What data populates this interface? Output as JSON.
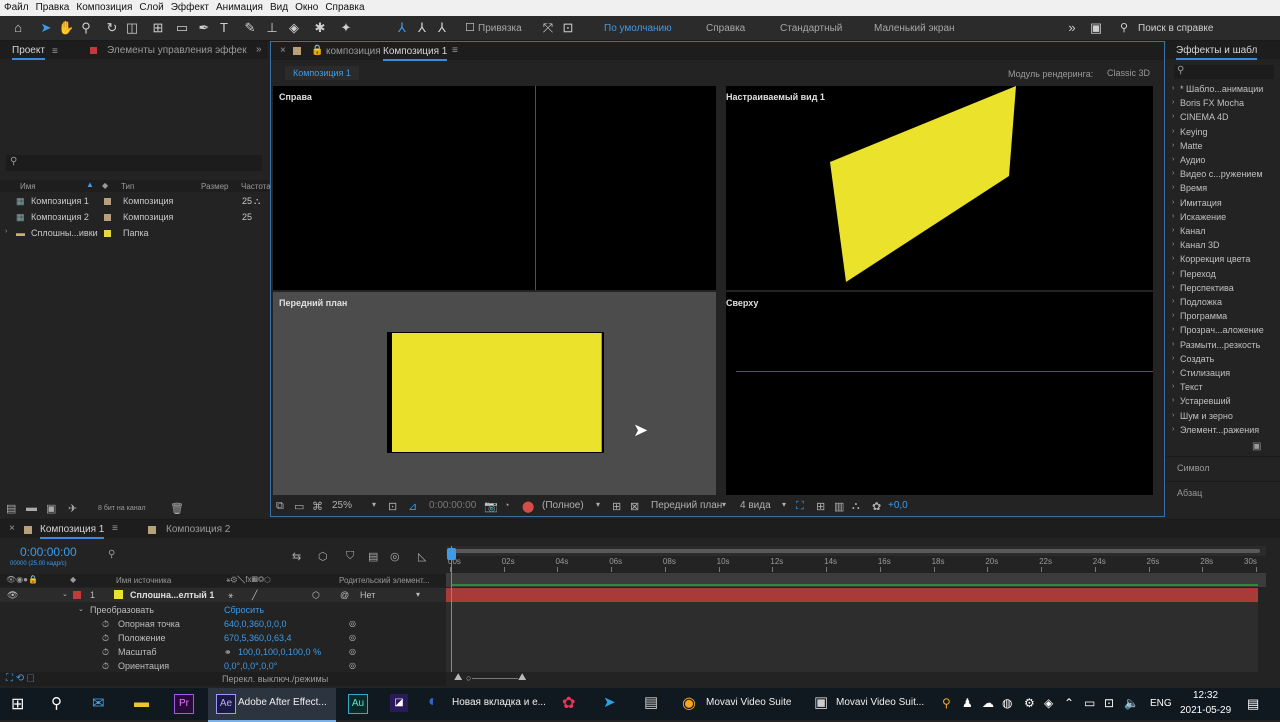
{
  "menu": [
    "Файл",
    "Правка",
    "Композиция",
    "Слой",
    "Эффект",
    "Анимация",
    "Вид",
    "Окно",
    "Справка"
  ],
  "toolbar": {
    "snap_label": "Привязка",
    "workspaces": [
      "По умолчанию",
      "Справка",
      "Стандартный",
      "Маленький экран"
    ],
    "search_placeholder": "Поиск в справке"
  },
  "project": {
    "tab_project": "Проект",
    "tab_effects_controls": "Элементы управления эффек",
    "search_placeholder": "",
    "columns": [
      "Имя",
      "Тип",
      "Размер",
      "Частота"
    ],
    "items": [
      {
        "name": "Композиция 1",
        "type": "Композиция",
        "rate": "25",
        "color": "#b8a07a"
      },
      {
        "name": "Композиция 2",
        "type": "Композиция",
        "rate": "25",
        "color": "#b8a07a"
      },
      {
        "name": "Сплошны...ивки",
        "type": "Папка",
        "rate": "",
        "color": "#e6d64b"
      }
    ],
    "bit_depth": "8 бит на канал"
  },
  "composition": {
    "tab_prefix": "композиция",
    "tab_name": "Композиция 1",
    "breadcrumb": "Композиция 1",
    "renderer_label": "Модуль рендеринга:",
    "renderer_value": "Classic 3D",
    "views": [
      "Справа",
      "Настраиваемый вид 1",
      "Передний план",
      "Сверху"
    ],
    "footer": {
      "zoom": "25%",
      "timecode": "0:00:00:00",
      "resolution": "(Полное)",
      "active_camera": "Передний план",
      "view_layout": "4 вида",
      "exposure": "+0,0"
    }
  },
  "effects_panel": {
    "title": "Эффекты и шабл",
    "search_placeholder": "",
    "items": [
      "* Шабло...анимации",
      "Boris FX Mocha",
      "CINEMA 4D",
      "Keying",
      "Matte",
      "Аудио",
      "Видео с...ружением",
      "Время",
      "Имитация",
      "Искажение",
      "Канал",
      "Канал 3D",
      "Коррекция цвета",
      "Переход",
      "Перспектива",
      "Подложка",
      "Программа",
      "Прозрач...аложение",
      "Размыти...резкость",
      "Создать",
      "Стилизация",
      "Текст",
      "Устаревший",
      "Шум и зерно",
      "Элемент...ражения"
    ],
    "symbol_panel": "Символ",
    "paragraph_panel": "Абзац"
  },
  "timeline": {
    "tabs": [
      "Композиция 1",
      "Композиция 2"
    ],
    "current_time": "0:00:00:00",
    "frame_info": "00000 (25.00 кадр/с)",
    "col_source": "Имя источника",
    "col_parent": "Родительский элемент...",
    "layer": {
      "index": "1",
      "name": "Сплошна...елтый 1",
      "parent": "Нет"
    },
    "transform_label": "Преобразовать",
    "reset_label": "Сбросить",
    "properties": [
      {
        "name": "Опорная точка",
        "value": "640,0,360,0,0,0"
      },
      {
        "name": "Положение",
        "value": "670,5,360,0,63,4"
      },
      {
        "name": "Масштаб",
        "value": "100,0,100,0,100,0 %"
      },
      {
        "name": "Ориентация",
        "value": "0,0°,0,0°,0,0°"
      }
    ],
    "toggle_label": "Перекл. выключ./режимы",
    "ruler": [
      "00s",
      "02s",
      "04s",
      "06s",
      "08s",
      "10s",
      "12s",
      "14s",
      "16s",
      "18s",
      "20s",
      "22s",
      "24s",
      "26s",
      "28s",
      "30s"
    ]
  },
  "taskbar": {
    "apps": [
      {
        "label": "Adobe After Effect..."
      },
      {
        "label": "Новая вкладка и е..."
      },
      {
        "label": "Movavi Video Suite"
      },
      {
        "label": "Movavi Video Suit..."
      }
    ],
    "lang": "ENG",
    "time": "12:32",
    "date": "2021-05-29"
  },
  "colors": {
    "accent": "#3d9be9",
    "layer_bar": "#a83a37",
    "solid_yellow": "#ebe22c"
  }
}
